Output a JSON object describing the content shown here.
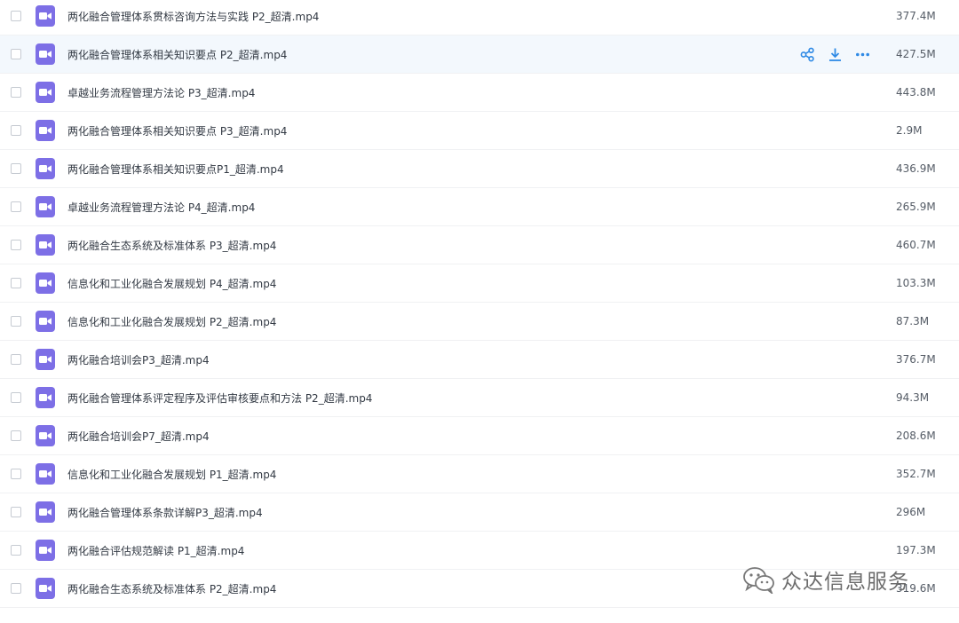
{
  "files": [
    {
      "name": "两化融合管理体系贯标咨询方法与实践 P2_超清.mp4",
      "size": "377.4M"
    },
    {
      "name": "两化融合管理体系相关知识要点 P2_超清.mp4",
      "size": "427.5M",
      "hovered": true
    },
    {
      "name": "卓越业务流程管理方法论 P3_超清.mp4",
      "size": "443.8M"
    },
    {
      "name": "两化融合管理体系相关知识要点 P3_超清.mp4",
      "size": "2.9M"
    },
    {
      "name": "两化融合管理体系相关知识要点P1_超清.mp4",
      "size": "436.9M"
    },
    {
      "name": "卓越业务流程管理方法论 P4_超清.mp4",
      "size": "265.9M"
    },
    {
      "name": "两化融合生态系统及标准体系 P3_超清.mp4",
      "size": "460.7M"
    },
    {
      "name": "信息化和工业化融合发展规划 P4_超清.mp4",
      "size": "103.3M"
    },
    {
      "name": "信息化和工业化融合发展规划 P2_超清.mp4",
      "size": "87.3M"
    },
    {
      "name": "两化融合培训会P3_超清.mp4",
      "size": "376.7M"
    },
    {
      "name": "两化融合管理体系评定程序及评估审核要点和方法 P2_超清.mp4",
      "size": "94.3M"
    },
    {
      "name": "两化融合培训会P7_超清.mp4",
      "size": "208.6M"
    },
    {
      "name": "信息化和工业化融合发展规划 P1_超清.mp4",
      "size": "352.7M"
    },
    {
      "name": "两化融合管理体系条款详解P3_超清.mp4",
      "size": "296M"
    },
    {
      "name": "两化融合评估规范解读 P1_超清.mp4",
      "size": "197.3M"
    },
    {
      "name": "两化融合生态系统及标准体系 P2_超清.mp4",
      "size": "319.6M"
    }
  ],
  "actions": {
    "share_icon": "share-icon",
    "download_icon": "download-icon",
    "more_icon": "more-icon"
  },
  "watermark": {
    "text": "众达信息服务"
  },
  "colors": {
    "icon_bg": "#7d6fe6",
    "action_blue": "#2f8ae5",
    "hover_bg": "#f3f8fd"
  }
}
